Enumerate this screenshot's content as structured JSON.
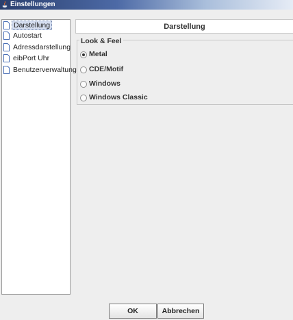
{
  "window": {
    "title": "Einstellungen"
  },
  "tree": {
    "items": [
      {
        "label": "Darstellung",
        "selected": true
      },
      {
        "label": "Autostart",
        "selected": false
      },
      {
        "label": "Adressdarstellung",
        "selected": false
      },
      {
        "label": "eibPort Uhr",
        "selected": false
      },
      {
        "label": "Benutzerverwaltung",
        "selected": false
      }
    ]
  },
  "content": {
    "header": "Darstellung",
    "group_title": "Look & Feel",
    "options": [
      {
        "label": "Metal",
        "checked": true
      },
      {
        "label": "CDE/Motif",
        "checked": false
      },
      {
        "label": "Windows",
        "checked": false
      },
      {
        "label": "Windows Classic",
        "checked": false
      }
    ]
  },
  "buttons": {
    "ok": "OK",
    "cancel": "Abbrechen"
  }
}
